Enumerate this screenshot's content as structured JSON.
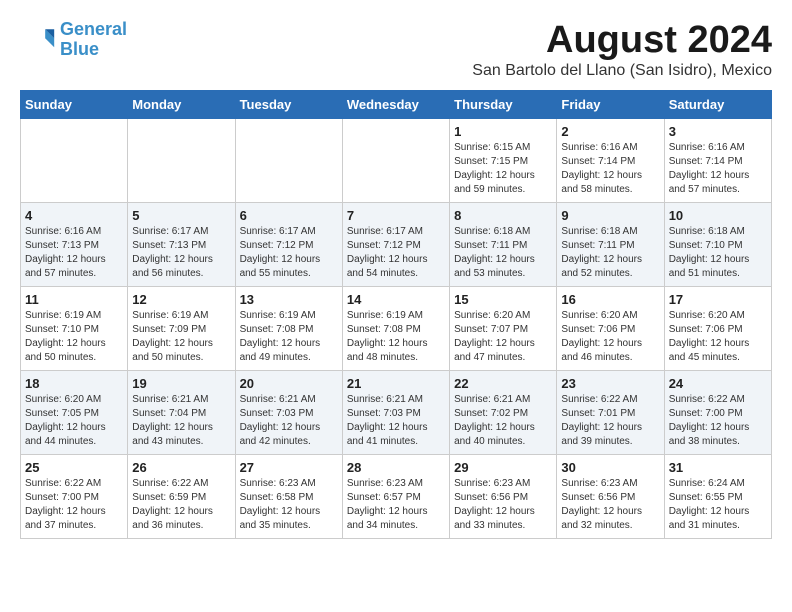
{
  "logo": {
    "line1": "General",
    "line2": "Blue"
  },
  "title": "August 2024",
  "subtitle": "San Bartolo del Llano (San Isidro), Mexico",
  "days_of_week": [
    "Sunday",
    "Monday",
    "Tuesday",
    "Wednesday",
    "Thursday",
    "Friday",
    "Saturday"
  ],
  "weeks": [
    [
      {
        "day": "",
        "content": ""
      },
      {
        "day": "",
        "content": ""
      },
      {
        "day": "",
        "content": ""
      },
      {
        "day": "",
        "content": ""
      },
      {
        "day": "1",
        "content": "Sunrise: 6:15 AM\nSunset: 7:15 PM\nDaylight: 12 hours\nand 59 minutes."
      },
      {
        "day": "2",
        "content": "Sunrise: 6:16 AM\nSunset: 7:14 PM\nDaylight: 12 hours\nand 58 minutes."
      },
      {
        "day": "3",
        "content": "Sunrise: 6:16 AM\nSunset: 7:14 PM\nDaylight: 12 hours\nand 57 minutes."
      }
    ],
    [
      {
        "day": "4",
        "content": "Sunrise: 6:16 AM\nSunset: 7:13 PM\nDaylight: 12 hours\nand 57 minutes."
      },
      {
        "day": "5",
        "content": "Sunrise: 6:17 AM\nSunset: 7:13 PM\nDaylight: 12 hours\nand 56 minutes."
      },
      {
        "day": "6",
        "content": "Sunrise: 6:17 AM\nSunset: 7:12 PM\nDaylight: 12 hours\nand 55 minutes."
      },
      {
        "day": "7",
        "content": "Sunrise: 6:17 AM\nSunset: 7:12 PM\nDaylight: 12 hours\nand 54 minutes."
      },
      {
        "day": "8",
        "content": "Sunrise: 6:18 AM\nSunset: 7:11 PM\nDaylight: 12 hours\nand 53 minutes."
      },
      {
        "day": "9",
        "content": "Sunrise: 6:18 AM\nSunset: 7:11 PM\nDaylight: 12 hours\nand 52 minutes."
      },
      {
        "day": "10",
        "content": "Sunrise: 6:18 AM\nSunset: 7:10 PM\nDaylight: 12 hours\nand 51 minutes."
      }
    ],
    [
      {
        "day": "11",
        "content": "Sunrise: 6:19 AM\nSunset: 7:10 PM\nDaylight: 12 hours\nand 50 minutes."
      },
      {
        "day": "12",
        "content": "Sunrise: 6:19 AM\nSunset: 7:09 PM\nDaylight: 12 hours\nand 50 minutes."
      },
      {
        "day": "13",
        "content": "Sunrise: 6:19 AM\nSunset: 7:08 PM\nDaylight: 12 hours\nand 49 minutes."
      },
      {
        "day": "14",
        "content": "Sunrise: 6:19 AM\nSunset: 7:08 PM\nDaylight: 12 hours\nand 48 minutes."
      },
      {
        "day": "15",
        "content": "Sunrise: 6:20 AM\nSunset: 7:07 PM\nDaylight: 12 hours\nand 47 minutes."
      },
      {
        "day": "16",
        "content": "Sunrise: 6:20 AM\nSunset: 7:06 PM\nDaylight: 12 hours\nand 46 minutes."
      },
      {
        "day": "17",
        "content": "Sunrise: 6:20 AM\nSunset: 7:06 PM\nDaylight: 12 hours\nand 45 minutes."
      }
    ],
    [
      {
        "day": "18",
        "content": "Sunrise: 6:20 AM\nSunset: 7:05 PM\nDaylight: 12 hours\nand 44 minutes."
      },
      {
        "day": "19",
        "content": "Sunrise: 6:21 AM\nSunset: 7:04 PM\nDaylight: 12 hours\nand 43 minutes."
      },
      {
        "day": "20",
        "content": "Sunrise: 6:21 AM\nSunset: 7:03 PM\nDaylight: 12 hours\nand 42 minutes."
      },
      {
        "day": "21",
        "content": "Sunrise: 6:21 AM\nSunset: 7:03 PM\nDaylight: 12 hours\nand 41 minutes."
      },
      {
        "day": "22",
        "content": "Sunrise: 6:21 AM\nSunset: 7:02 PM\nDaylight: 12 hours\nand 40 minutes."
      },
      {
        "day": "23",
        "content": "Sunrise: 6:22 AM\nSunset: 7:01 PM\nDaylight: 12 hours\nand 39 minutes."
      },
      {
        "day": "24",
        "content": "Sunrise: 6:22 AM\nSunset: 7:00 PM\nDaylight: 12 hours\nand 38 minutes."
      }
    ],
    [
      {
        "day": "25",
        "content": "Sunrise: 6:22 AM\nSunset: 7:00 PM\nDaylight: 12 hours\nand 37 minutes."
      },
      {
        "day": "26",
        "content": "Sunrise: 6:22 AM\nSunset: 6:59 PM\nDaylight: 12 hours\nand 36 minutes."
      },
      {
        "day": "27",
        "content": "Sunrise: 6:23 AM\nSunset: 6:58 PM\nDaylight: 12 hours\nand 35 minutes."
      },
      {
        "day": "28",
        "content": "Sunrise: 6:23 AM\nSunset: 6:57 PM\nDaylight: 12 hours\nand 34 minutes."
      },
      {
        "day": "29",
        "content": "Sunrise: 6:23 AM\nSunset: 6:56 PM\nDaylight: 12 hours\nand 33 minutes."
      },
      {
        "day": "30",
        "content": "Sunrise: 6:23 AM\nSunset: 6:56 PM\nDaylight: 12 hours\nand 32 minutes."
      },
      {
        "day": "31",
        "content": "Sunrise: 6:24 AM\nSunset: 6:55 PM\nDaylight: 12 hours\nand 31 minutes."
      }
    ]
  ]
}
